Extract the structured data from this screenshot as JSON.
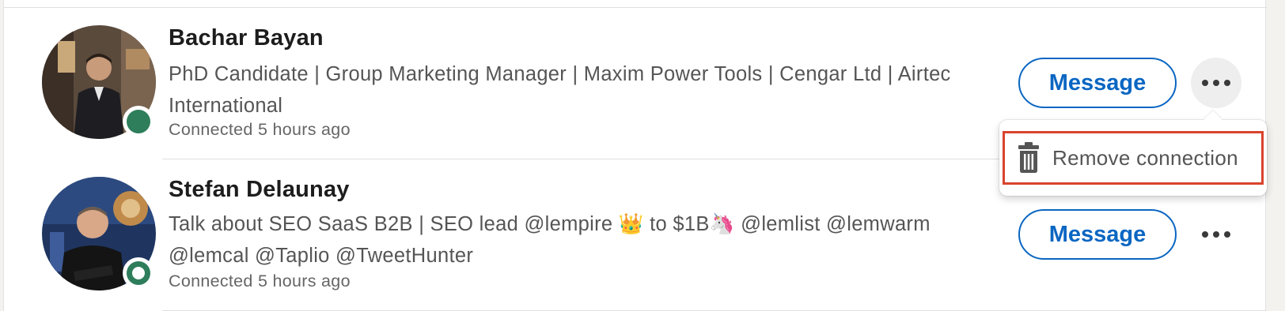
{
  "connections": [
    {
      "name": "Bachar Bayan",
      "headline": "PhD Candidate | Group Marketing Manager | Maxim Power Tools | Cengar Ltd | Airtec International",
      "connected": "Connected 5 hours ago",
      "message_label": "Message",
      "presence": "online"
    },
    {
      "name": "Stefan Delaunay",
      "headline": "Talk about SEO SaaS B2B | SEO lead @lempire 👑 to $1B🦄 @lemlist @lemwarm @lemcal @Taplio @TweetHunter",
      "connected": "Connected 5 hours ago",
      "message_label": "Message",
      "presence": "active-recently"
    }
  ],
  "menu": {
    "items": [
      {
        "label": "Remove connection",
        "icon": "trash-icon"
      }
    ]
  },
  "colors": {
    "accent": "#0a66c2",
    "presence": "#2e7d5b",
    "highlight": "#d9432c"
  }
}
